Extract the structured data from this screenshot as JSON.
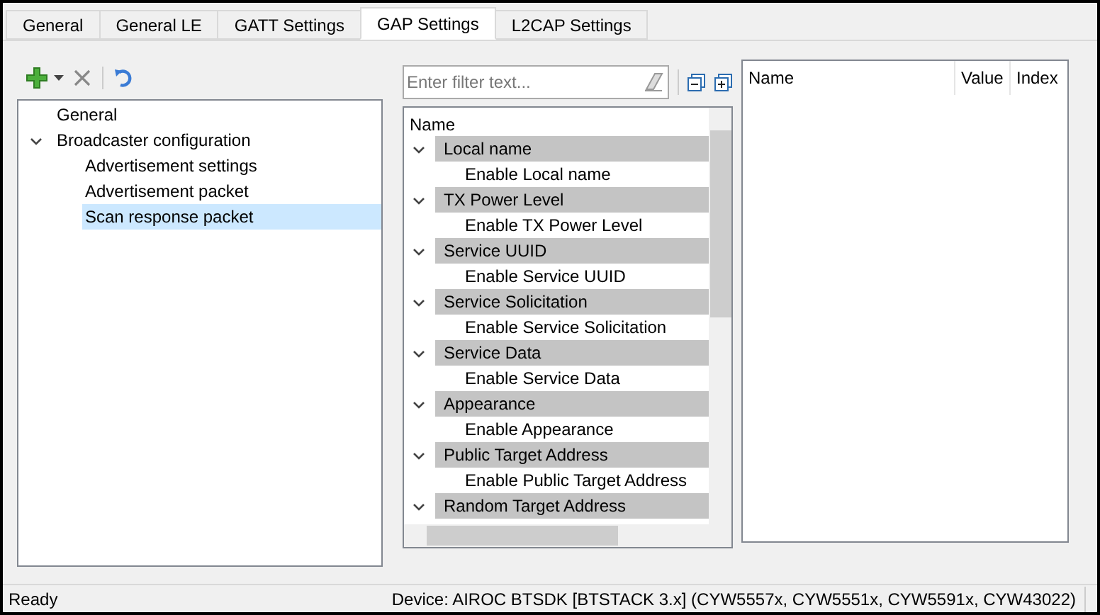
{
  "tabs": [
    {
      "label": "General",
      "selected": false
    },
    {
      "label": "General LE",
      "selected": false
    },
    {
      "label": "GATT Settings",
      "selected": false
    },
    {
      "label": "GAP Settings",
      "selected": true
    },
    {
      "label": "L2CAP Settings",
      "selected": false
    }
  ],
  "config_tree": [
    {
      "label": "General",
      "selected": false
    },
    {
      "label": "Broadcaster configuration",
      "selected": false,
      "expanded": true,
      "children": [
        {
          "label": "Advertisement settings",
          "selected": false
        },
        {
          "label": "Advertisement packet",
          "selected": false
        },
        {
          "label": "Scan response packet",
          "selected": true
        }
      ]
    }
  ],
  "filter": {
    "placeholder": "Enter filter text..."
  },
  "field_tree": {
    "column": "Name",
    "groups": [
      {
        "label": "Local name",
        "expanded": true,
        "children": [
          "Enable Local name"
        ]
      },
      {
        "label": "TX Power Level",
        "expanded": true,
        "children": [
          "Enable TX Power Level"
        ]
      },
      {
        "label": "Service UUID",
        "expanded": true,
        "children": [
          "Enable Service UUID"
        ]
      },
      {
        "label": "Service Solicitation",
        "expanded": true,
        "children": [
          "Enable Service Solicitation"
        ]
      },
      {
        "label": "Service Data",
        "expanded": true,
        "children": [
          "Enable Service Data"
        ]
      },
      {
        "label": "Appearance",
        "expanded": true,
        "children": [
          "Enable Appearance"
        ]
      },
      {
        "label": "Public Target Address",
        "expanded": true,
        "children": [
          "Enable Public Target Address"
        ]
      },
      {
        "label": "Random Target Address",
        "expanded": true
      }
    ]
  },
  "properties_table": {
    "columns": [
      "Name",
      "Value",
      "Index"
    ]
  },
  "status_bar": {
    "left": "Ready",
    "right": "Device: AIROC BTSDK [BTSTACK 3.x] (CYW5557x, CYW5551x, CYW5591x, CYW43022)"
  }
}
